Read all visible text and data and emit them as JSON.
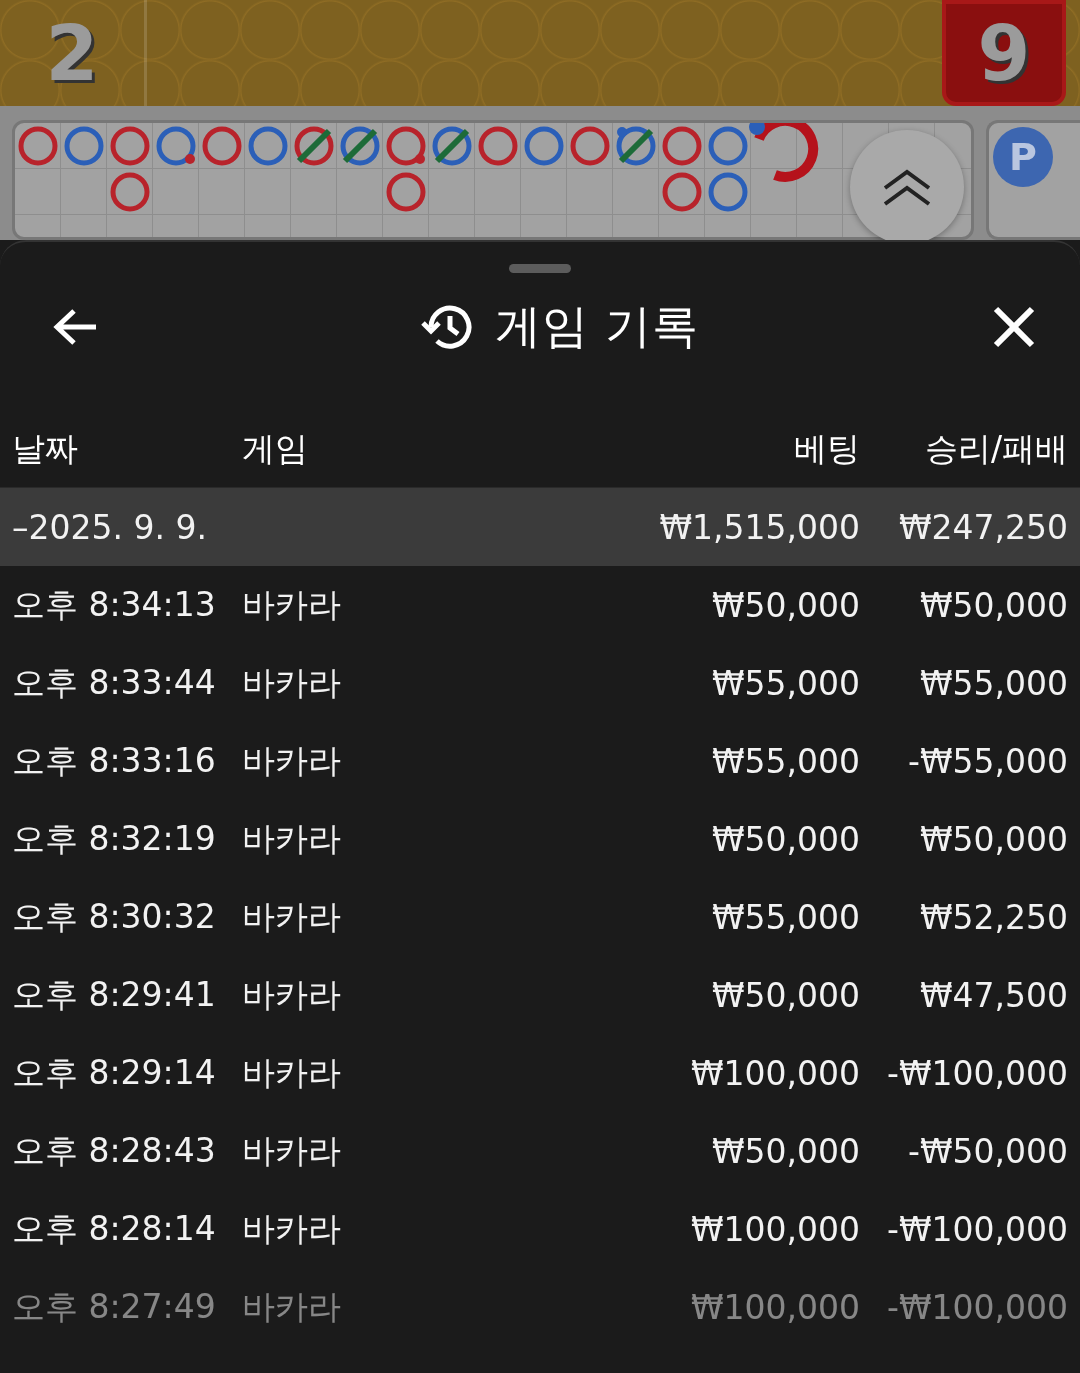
{
  "game": {
    "player_score": "2",
    "banker_score": "9",
    "side_road_label": "P",
    "bead_road": [
      [
        {
          "color": "#b8232b",
          "tie": false,
          "banker_pair": false,
          "player_pair": false
        }
      ],
      [
        {
          "color": "#2b5fb8",
          "tie": false,
          "banker_pair": false,
          "player_pair": false
        }
      ],
      [
        {
          "color": "#b8232b",
          "tie": false,
          "banker_pair": false,
          "player_pair": false
        },
        {
          "color": "#b8232b",
          "tie": false,
          "banker_pair": false,
          "player_pair": false
        }
      ],
      [
        {
          "color": "#2b5fb8",
          "tie": false,
          "banker_pair": true,
          "player_pair": false
        }
      ],
      [
        {
          "color": "#b8232b",
          "tie": false,
          "banker_pair": false,
          "player_pair": false
        }
      ],
      [
        {
          "color": "#2b5fb8",
          "tie": false,
          "banker_pair": false,
          "player_pair": false
        }
      ],
      [
        {
          "color": "#b8232b",
          "tie": true,
          "banker_pair": false,
          "player_pair": false
        }
      ],
      [
        {
          "color": "#2b5fb8",
          "tie": true,
          "banker_pair": false,
          "player_pair": false
        }
      ],
      [
        {
          "color": "#b8232b",
          "tie": false,
          "banker_pair": true,
          "player_pair": false
        },
        {
          "color": "#b8232b",
          "tie": false,
          "banker_pair": false,
          "player_pair": false
        }
      ],
      [
        {
          "color": "#2b5fb8",
          "tie": true,
          "banker_pair": false,
          "player_pair": false
        }
      ],
      [
        {
          "color": "#b8232b",
          "tie": false,
          "banker_pair": false,
          "player_pair": false
        }
      ],
      [
        {
          "color": "#2b5fb8",
          "tie": false,
          "banker_pair": false,
          "player_pair": false
        }
      ],
      [
        {
          "color": "#b8232b",
          "tie": false,
          "banker_pair": false,
          "player_pair": false
        }
      ],
      [
        {
          "color": "#2b5fb8",
          "tie": true,
          "banker_pair": false,
          "player_pair": true
        }
      ],
      [
        {
          "color": "#b8232b",
          "tie": false,
          "banker_pair": false,
          "player_pair": false
        },
        {
          "color": "#b8232b",
          "tie": false,
          "banker_pair": false,
          "player_pair": false
        }
      ],
      [
        {
          "color": "#2b5fb8",
          "tie": false,
          "banker_pair": false,
          "player_pair": false
        },
        {
          "color": "#2b5fb8",
          "tie": false,
          "banker_pair": false,
          "player_pair": false
        }
      ]
    ]
  },
  "sheet": {
    "title": "게임 기록",
    "columns": [
      "날짜",
      "게임",
      "베팅",
      "승리/패배"
    ],
    "group": {
      "date": "–2025. 9. 9.",
      "bet": "₩1,515,000",
      "result": "₩247,250"
    },
    "rows": [
      {
        "time": "오후 8:34:13",
        "game": "바카라",
        "bet": "₩50,000",
        "result": "₩50,000",
        "dimmed": false
      },
      {
        "time": "오후 8:33:44",
        "game": "바카라",
        "bet": "₩55,000",
        "result": "₩55,000",
        "dimmed": false
      },
      {
        "time": "오후 8:33:16",
        "game": "바카라",
        "bet": "₩55,000",
        "result": "-₩55,000",
        "dimmed": false
      },
      {
        "time": "오후 8:32:19",
        "game": "바카라",
        "bet": "₩50,000",
        "result": "₩50,000",
        "dimmed": false
      },
      {
        "time": "오후 8:30:32",
        "game": "바카라",
        "bet": "₩55,000",
        "result": "₩52,250",
        "dimmed": false
      },
      {
        "time": "오후 8:29:41",
        "game": "바카라",
        "bet": "₩50,000",
        "result": "₩47,500",
        "dimmed": false
      },
      {
        "time": "오후 8:29:14",
        "game": "바카라",
        "bet": "₩100,000",
        "result": "-₩100,000",
        "dimmed": false
      },
      {
        "time": "오후 8:28:43",
        "game": "바카라",
        "bet": "₩50,000",
        "result": "-₩50,000",
        "dimmed": false
      },
      {
        "time": "오후 8:28:14",
        "game": "바카라",
        "bet": "₩100,000",
        "result": "-₩100,000",
        "dimmed": false
      },
      {
        "time": "오후 8:27:49",
        "game": "바카라",
        "bet": "₩100,000",
        "result": "-₩100,000",
        "dimmed": true
      }
    ]
  }
}
